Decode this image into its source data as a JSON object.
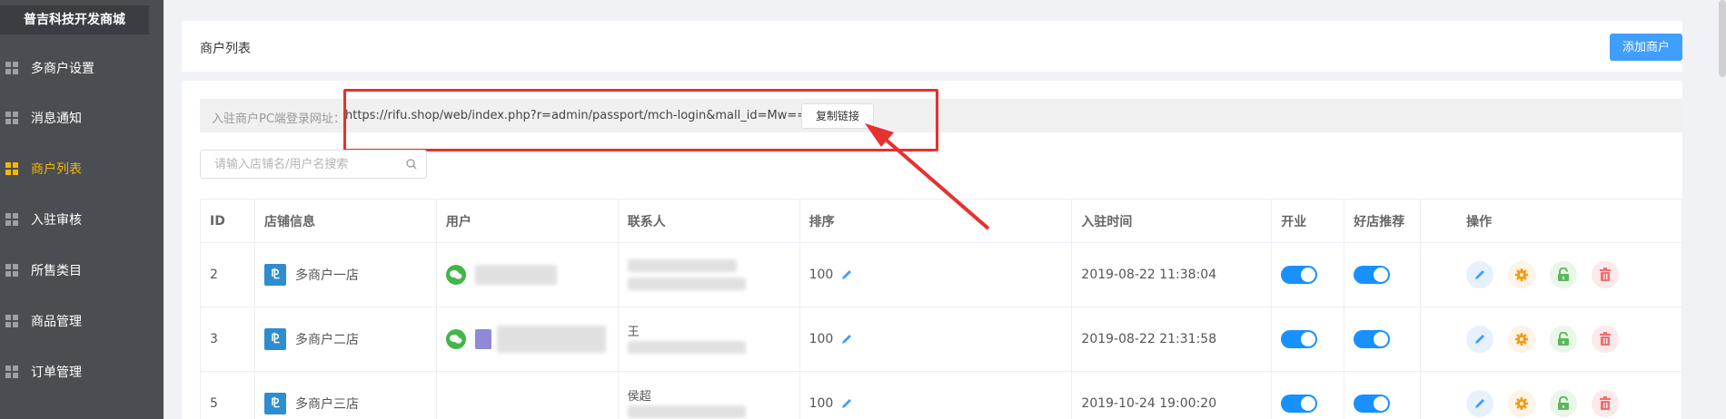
{
  "sidebar": {
    "brand": "普吉科技开发商城",
    "items": [
      {
        "label": "多商户设置",
        "active": false
      },
      {
        "label": "消息通知",
        "active": false
      },
      {
        "label": "商户列表",
        "active": true
      },
      {
        "label": "入驻审核",
        "active": false
      },
      {
        "label": "所售类目",
        "active": false
      },
      {
        "label": "商品管理",
        "active": false
      },
      {
        "label": "订单管理",
        "active": false
      }
    ],
    "active_color": "#f5b700"
  },
  "header": {
    "title": "商户列表",
    "add_button": "添加商户"
  },
  "url_bar": {
    "label": "入驻商户PC端登录网址：",
    "url": "https://rifu.shop/web/index.php?r=admin/passport/mch-login&mall_id=Mw==",
    "copy_button": "复制链接"
  },
  "search": {
    "placeholder": "请输入店铺名/用户名搜索"
  },
  "table": {
    "headers": [
      "ID",
      "店铺信息",
      "用户",
      "联系人",
      "排序",
      "入驻时间",
      "开业",
      "好店推荐",
      "操作"
    ],
    "rows": [
      {
        "id": "2",
        "shop": "多商户一店",
        "user": "",
        "contact_line1": "",
        "contact_line2": "",
        "sort": "100",
        "time": "2019-08-22 11:38:04",
        "open": true,
        "recommend": true
      },
      {
        "id": "3",
        "shop": "多商户二店",
        "user": "",
        "contact_line1": "王",
        "contact_line2": "",
        "sort": "100",
        "time": "2019-08-22 21:31:58",
        "open": true,
        "recommend": true
      },
      {
        "id": "5",
        "shop": "多商户三店",
        "user": "",
        "contact_line1": "侯超",
        "contact_line2": "",
        "sort": "100",
        "time": "2019-10-24 19:00:20",
        "open": true,
        "recommend": true
      }
    ]
  },
  "colors": {
    "primary": "#409eff",
    "switch_on": "#1890ff",
    "highlight": "#e8302f"
  }
}
